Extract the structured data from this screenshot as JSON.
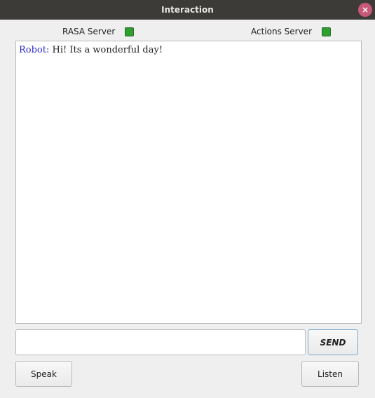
{
  "window": {
    "title": "Interaction",
    "close_glyph": "×"
  },
  "status": {
    "rasa": {
      "label": "RASA Server",
      "color": "#2e9e2e"
    },
    "actions": {
      "label": "Actions Server",
      "color": "#2e9e2e"
    }
  },
  "chat": {
    "messages": [
      {
        "speaker": "Robot:",
        "text": " Hi! Its a wonderful day!"
      }
    ]
  },
  "input": {
    "value": "",
    "placeholder": ""
  },
  "buttons": {
    "send": "SEND",
    "speak": "Speak",
    "listen": "Listen"
  }
}
